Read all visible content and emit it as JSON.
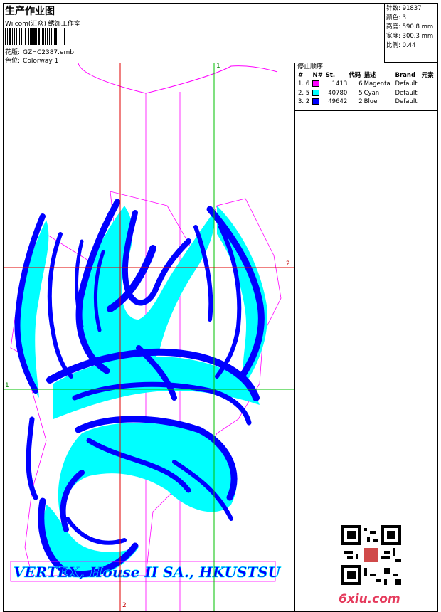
{
  "header": {
    "title": "生产作业图",
    "subtitle": "Wilcom(汇众) 绣饰工作室",
    "design_label": "花版:",
    "design_value": "GZHC2387.emb",
    "colorway_label": "色位:",
    "colorway_value": "Colorway 1"
  },
  "stats": {
    "stitches": "针数: 91837",
    "colors": "颜色: 3",
    "height": "高度: 590.8 mm",
    "width": "宽度: 300.3 mm",
    "scale": "比例: 0.44"
  },
  "sequence": {
    "title": "停止顺序:",
    "headers": [
      "#",
      "N#",
      "St.",
      "代码",
      "描述",
      "Brand",
      "元素"
    ],
    "rows": [
      {
        "index": "1. 6",
        "color": "#ff00ff",
        "stitches": "1413",
        "code": "6",
        "desc": "Magenta",
        "brand": "Default"
      },
      {
        "index": "2. 5",
        "color": "#00ffff",
        "stitches": "40780",
        "code": "5",
        "desc": "Cyan",
        "brand": "Default"
      },
      {
        "index": "3. 2",
        "color": "#0000ff",
        "stitches": "49642",
        "code": "2",
        "desc": "Blue",
        "brand": "Default"
      }
    ]
  },
  "canvas": {
    "guide_labels": {
      "top_green": "1",
      "right_red": "2",
      "left_green": "1",
      "bottom_red": "2"
    },
    "banner_text": "VERTEX, House II SA., HKUSTSU",
    "colors": {
      "magenta": "#ff00ff",
      "cyan": "#00ffff",
      "blue": "#0000ff",
      "guide_red": "#e00000",
      "guide_green": "#00c000"
    }
  },
  "watermark": {
    "site": "6xiu.com"
  }
}
